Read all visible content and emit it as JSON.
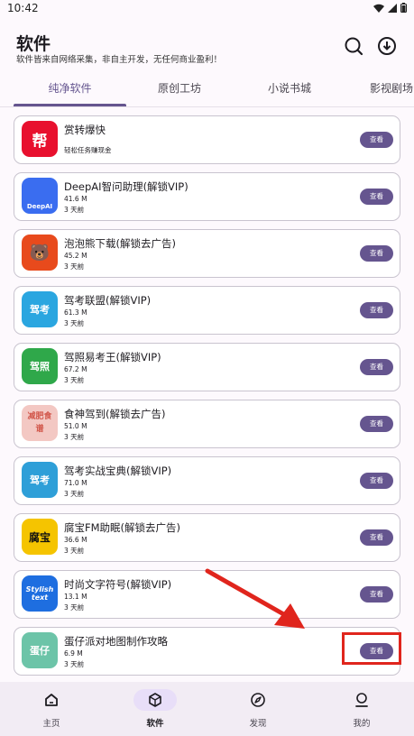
{
  "status_bar": {
    "time": "10:42"
  },
  "header": {
    "title": "软件",
    "subtitle": "软件皆来自网络采集，非自主开发，无任何商业盈利！"
  },
  "tabs": [
    {
      "label": "纯净软件",
      "active": true
    },
    {
      "label": "原创工坊",
      "active": false
    },
    {
      "label": "小说书城",
      "active": false
    },
    {
      "label": "影视剧场",
      "active": false
    }
  ],
  "apps": [
    {
      "name": "赏转爆快",
      "desc": "轻松任务赚现金",
      "button": "查看",
      "icon": "bang-app-icon",
      "icon_text": "帮",
      "color": "#e8102e"
    },
    {
      "name": "DeepAI智问助理(解锁VIP)",
      "size": "41.6 M",
      "time": "3 天前",
      "button": "查看",
      "icon": "robot-icon",
      "icon_text": "DeepAI",
      "color": "#3a6df0"
    },
    {
      "name": "泡泡熊下载(解锁去广告)",
      "size": "45.2 M",
      "time": "3 天前",
      "button": "查看",
      "icon": "bear-icon",
      "icon_text": "🐻",
      "color": "#e84a1c"
    },
    {
      "name": "驾考联盟(解锁VIP)",
      "size": "61.3 M",
      "time": "3 天前",
      "button": "查看",
      "icon": "car-icon",
      "icon_text": "驾考",
      "color": "#2aa6e0"
    },
    {
      "name": "驾照易考王(解锁VIP)",
      "size": "67.2 M",
      "time": "3 天前",
      "button": "查看",
      "icon": "taxi-icon",
      "icon_text": "驾照",
      "color": "#2fa84a"
    },
    {
      "name": "食神驾到(解锁去广告)",
      "size": "51.0 M",
      "time": "3 天前",
      "button": "查看",
      "icon": "recipe-icon",
      "icon_text": "减肥食谱",
      "color": "#f3c8c3"
    },
    {
      "name": "驾考实战宝典(解锁VIP)",
      "size": "71.0 M",
      "time": "3 天前",
      "button": "查看",
      "icon": "road-icon",
      "icon_text": "驾考",
      "color": "#2e9fd8"
    },
    {
      "name": "腐宝FM助眠(解锁去广告)",
      "size": "36.6 M",
      "time": "3 天前",
      "button": "查看",
      "icon": "fubao-icon",
      "icon_text": "腐宝",
      "color": "#f5c400"
    },
    {
      "name": "时尚文字符号(解锁VIP)",
      "size": "13.1 M",
      "time": "3 天前",
      "button": "查看",
      "icon": "stylish-text-icon",
      "icon_text": "Stylish text",
      "color": "#1e6ee0"
    },
    {
      "name": "蛋仔派对地图制作攻略",
      "size": "6.9 M",
      "time": "3 天前",
      "button": "查看",
      "icon": "eggy-map-icon",
      "icon_text": "蛋仔",
      "color": "#6cc4a8"
    }
  ],
  "bottom_nav": [
    {
      "label": "主页",
      "icon": "home-icon",
      "active": false
    },
    {
      "label": "软件",
      "icon": "cube-icon",
      "active": true
    },
    {
      "label": "发现",
      "icon": "compass-icon",
      "active": false
    },
    {
      "label": "我的",
      "icon": "person-icon",
      "active": false
    }
  ]
}
